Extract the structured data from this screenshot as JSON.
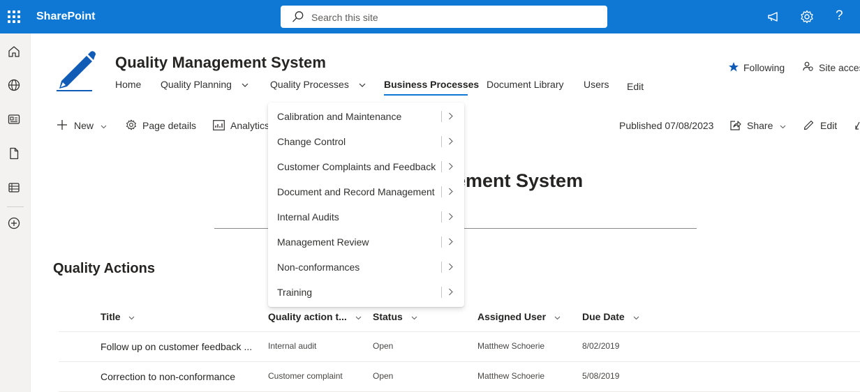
{
  "suitebar": {
    "app_name": "SharePoint",
    "search_placeholder": "Search this site",
    "icons": [
      "app-launcher-icon",
      "megaphone-icon",
      "gear-icon",
      "help-icon"
    ],
    "help_label": "?",
    "brand_color": "#0f78d4"
  },
  "rail": {
    "icons": [
      "home-icon",
      "globe-icon",
      "news-icon",
      "document-icon",
      "list-icon",
      "add-icon"
    ]
  },
  "site": {
    "title": "Quality Management System",
    "nav": [
      {
        "label": "Home",
        "has_chevron": false
      },
      {
        "label": "Quality Planning",
        "has_chevron": true
      },
      {
        "label": "Quality Processes",
        "has_chevron": true
      },
      {
        "label": "Business Processes",
        "has_chevron": false,
        "active": true
      },
      {
        "label": "Document Library",
        "has_chevron": false
      },
      {
        "label": "Users",
        "has_chevron": false
      },
      {
        "label": "Edit",
        "has_chevron": false
      }
    ],
    "following_label": "Following",
    "site_access_label": "Site access"
  },
  "commandbar": {
    "new_label": "New",
    "page_details_label": "Page details",
    "analytics_label": "Analytics",
    "published_label": "Published 07/08/2023",
    "share_label": "Share",
    "edit_label": "Edit"
  },
  "page": {
    "title_visible": "ement System"
  },
  "dropdown": {
    "items": [
      "Calibration and Maintenance",
      "Change Control",
      "Customer Complaints and Feedback",
      "Document and Record Management",
      "Internal Audits",
      "Management Review",
      "Non-conformances",
      "Training"
    ]
  },
  "quality_actions": {
    "heading": "Quality Actions",
    "columns": [
      "Title",
      "Quality action t...",
      "Status",
      "Assigned User",
      "Due Date"
    ],
    "rows": [
      {
        "title": "Follow up on customer feedback ...",
        "type": "Internal audit",
        "status": "Open",
        "user": "Matthew Schoerie",
        "due": "8/02/2019"
      },
      {
        "title": "Correction to non-conformance",
        "type": "Customer complaint",
        "status": "Open",
        "user": "Matthew Schoerie",
        "due": "5/08/2019"
      }
    ]
  }
}
